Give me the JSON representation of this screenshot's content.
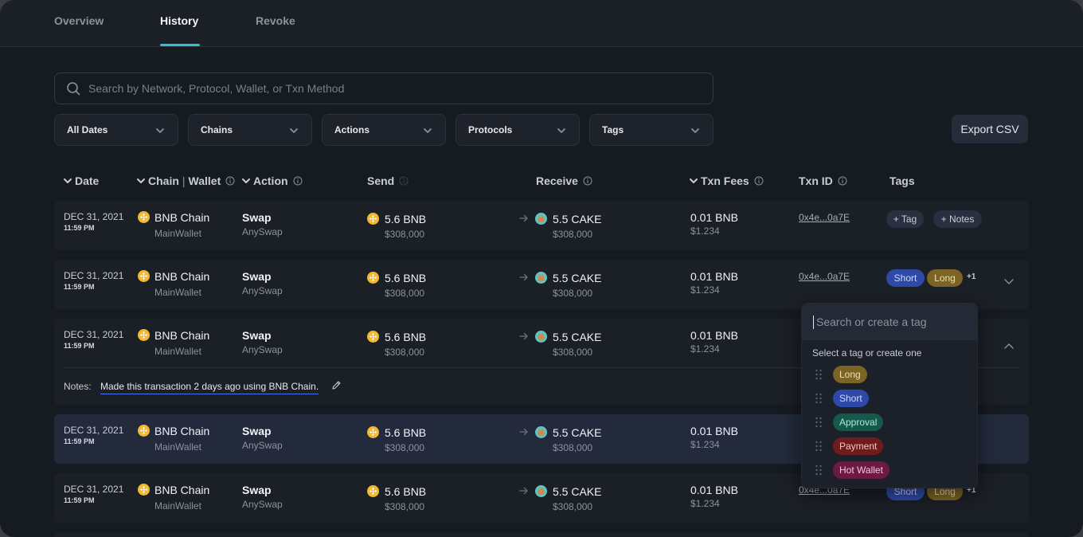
{
  "tabs": [
    {
      "label": "Overview"
    },
    {
      "label": "History"
    },
    {
      "label": "Revoke"
    }
  ],
  "search": {
    "placeholder": "Search by Network, Protocol, Wallet, or Txn Method"
  },
  "filters": [
    {
      "label": "All Dates"
    },
    {
      "label": "Chains"
    },
    {
      "label": "Actions"
    },
    {
      "label": "Protocols"
    },
    {
      "label": "Tags"
    }
  ],
  "export_label": "Export CSV",
  "columns": {
    "date": "Date",
    "chain": "Chain",
    "wallet": "Wallet",
    "action": "Action",
    "send": "Send",
    "receive": "Receive",
    "fees": "Txn Fees",
    "txid": "Txn ID",
    "tags": "Tags"
  },
  "rows": [
    {
      "date": "DEC 31, 2021",
      "time": "11:59 PM",
      "chain": "BNB Chain",
      "wallet": "MainWallet",
      "action": "Swap",
      "protocol": "AnySwap",
      "send": "5.6 BNB",
      "send_usd": "$308,000",
      "receive": "5.5 CAKE",
      "receive_usd": "$308,000",
      "fee": "0.01 BNB",
      "fee_usd": "$1.234",
      "txid": "0x4e...0a7E",
      "add_tag": "+ Tag",
      "add_notes": "+ Notes"
    },
    {
      "date": "DEC 31, 2021",
      "time": "11:59 PM",
      "chain": "BNB Chain",
      "wallet": "MainWallet",
      "action": "Swap",
      "protocol": "AnySwap",
      "send": "5.6 BNB",
      "send_usd": "$308,000",
      "receive": "5.5 CAKE",
      "receive_usd": "$308,000",
      "fee": "0.01 BNB",
      "fee_usd": "$1.234",
      "txid": "0x4e...0a7E",
      "tag1": "Short",
      "tag2": "Long",
      "more": "+1"
    },
    {
      "date": "DEC 31, 2021",
      "time": "11:59 PM",
      "chain": "BNB Chain",
      "wallet": "MainWallet",
      "action": "Swap",
      "protocol": "AnySwap",
      "send": "5.6 BNB",
      "send_usd": "$308,000",
      "receive": "5.5 CAKE",
      "receive_usd": "$308,000",
      "fee": "0.01 BNB",
      "fee_usd": "$1.234",
      "notes_label": "Notes:",
      "notes": "Made this transaction 2 days ago using BNB Chain."
    },
    {
      "date": "DEC 31, 2021",
      "time": "11:59 PM",
      "chain": "BNB Chain",
      "wallet": "MainWallet",
      "action": "Swap",
      "protocol": "AnySwap",
      "send": "5.6 BNB",
      "send_usd": "$308,000",
      "receive": "5.5 CAKE",
      "receive_usd": "$308,000",
      "fee": "0.01 BNB",
      "fee_usd": "$1.234"
    },
    {
      "date": "DEC 31, 2021",
      "time": "11:59 PM",
      "chain": "BNB Chain",
      "wallet": "MainWallet",
      "action": "Swap",
      "protocol": "AnySwap",
      "send": "5.6 BNB",
      "send_usd": "$308,000",
      "receive": "5.5 CAKE",
      "receive_usd": "$308,000",
      "fee": "0.01 BNB",
      "fee_usd": "$1.234",
      "txid": "0x4e...0a7E",
      "tag1": "Short",
      "tag2": "Long",
      "more": "+1"
    }
  ],
  "tag_dropdown": {
    "placeholder": "Search or create a tag",
    "hint": "Select a tag or create one",
    "tags": [
      {
        "label": "Long",
        "bg": "#7c6426",
        "fg": "#f1dfae"
      },
      {
        "label": "Short",
        "bg": "#2f49a8",
        "fg": "#cfd8ff"
      },
      {
        "label": "Approval",
        "bg": "#17584d",
        "fg": "#a5ecd8"
      },
      {
        "label": "Payment",
        "bg": "#6e1c1c",
        "fg": "#f5c2c2"
      },
      {
        "label": "Hot Wallet",
        "bg": "#6b1a44",
        "fg": "#f7c3dd"
      }
    ]
  },
  "colors": {
    "accent": "#2fc3cf",
    "bnb": "#f3ba2f",
    "cake": "#5fc4c6",
    "background": "#161a21"
  }
}
